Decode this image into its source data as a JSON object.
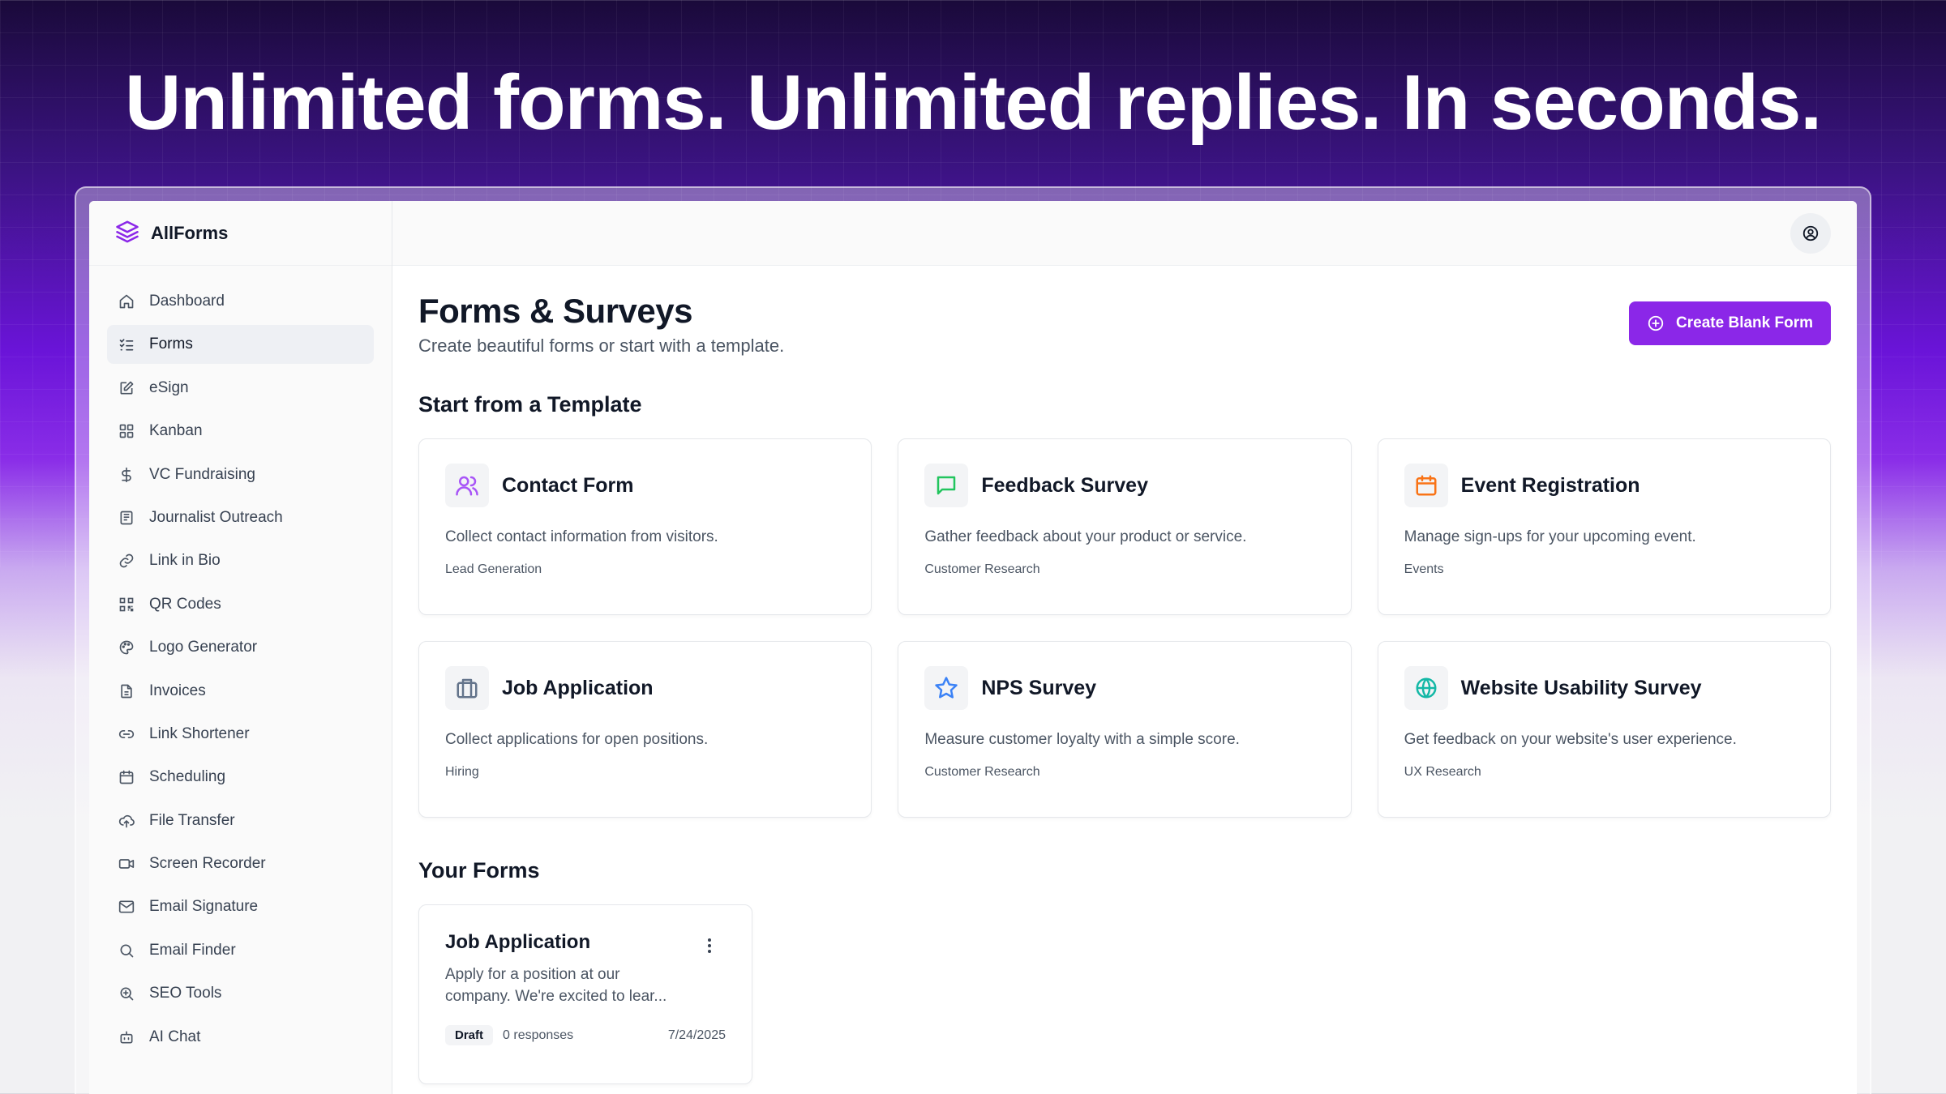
{
  "headline": "Unlimited forms. Unlimited replies. In seconds.",
  "brand": {
    "name": "AllForms",
    "icon": "layers-icon",
    "accent": "#8b27e8"
  },
  "sidebar": {
    "items": [
      {
        "label": "Dashboard",
        "icon": "home-icon"
      },
      {
        "label": "Forms",
        "icon": "list-checks-icon",
        "active": true
      },
      {
        "label": "eSign",
        "icon": "pen-square-icon"
      },
      {
        "label": "Kanban",
        "icon": "grid-icon"
      },
      {
        "label": "VC Fundraising",
        "icon": "dollar-icon"
      },
      {
        "label": "Journalist Outreach",
        "icon": "newspaper-icon"
      },
      {
        "label": "Link in Bio",
        "icon": "link-icon"
      },
      {
        "label": "QR Codes",
        "icon": "qr-code-icon"
      },
      {
        "label": "Logo Generator",
        "icon": "palette-icon"
      },
      {
        "label": "Invoices",
        "icon": "file-text-icon"
      },
      {
        "label": "Link Shortener",
        "icon": "link-2-icon"
      },
      {
        "label": "Scheduling",
        "icon": "calendar-icon"
      },
      {
        "label": "File Transfer",
        "icon": "cloud-upload-icon"
      },
      {
        "label": "Screen Recorder",
        "icon": "video-icon"
      },
      {
        "label": "Email Signature",
        "icon": "mail-icon"
      },
      {
        "label": "Email Finder",
        "icon": "search-icon"
      },
      {
        "label": "SEO Tools",
        "icon": "zoom-in-icon"
      },
      {
        "label": "AI Chat",
        "icon": "bot-icon"
      }
    ]
  },
  "header": {
    "account_icon": "user-circle-icon"
  },
  "main": {
    "title": "Forms & Surveys",
    "subtitle": "Create beautiful forms or start with a template.",
    "create_button": "Create Blank Form",
    "templates_title": "Start from a Template",
    "templates": [
      {
        "title": "Contact Form",
        "desc": "Collect contact information from visitors.",
        "tag": "Lead Generation",
        "icon": "users-icon",
        "color": "#a855f7"
      },
      {
        "title": "Feedback Survey",
        "desc": "Gather feedback about your product or service.",
        "tag": "Customer Research",
        "icon": "message-square-icon",
        "color": "#22c55e"
      },
      {
        "title": "Event Registration",
        "desc": "Manage sign-ups for your upcoming event.",
        "tag": "Events",
        "icon": "calendar-icon",
        "color": "#f97316"
      },
      {
        "title": "Job Application",
        "desc": "Collect applications for open positions.",
        "tag": "Hiring",
        "icon": "briefcase-icon",
        "color": "#64748b"
      },
      {
        "title": "NPS Survey",
        "desc": "Measure customer loyalty with a simple score.",
        "tag": "Customer Research",
        "icon": "star-icon",
        "color": "#3b82f6"
      },
      {
        "title": "Website Usability Survey",
        "desc": "Get feedback on your website's user experience.",
        "tag": "UX Research",
        "icon": "globe-icon",
        "color": "#14b8a6"
      }
    ],
    "your_forms_title": "Your Forms",
    "forms": [
      {
        "title": "Job Application",
        "desc": "Apply for a position at our company. We're excited to lear...",
        "status": "Draft",
        "responses": "0 responses",
        "date": "7/24/2025"
      }
    ]
  }
}
